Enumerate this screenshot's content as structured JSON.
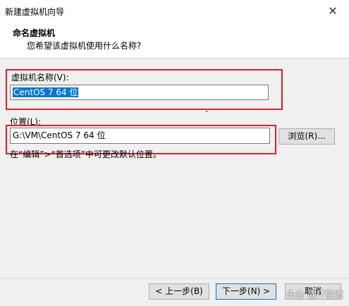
{
  "window": {
    "title": "新建虚拟机向导",
    "close_glyph": "✕"
  },
  "header": {
    "title": "命名虚拟机",
    "subtitle": "您希望该虚拟机使用什么名称?"
  },
  "name_field": {
    "label": "虚拟机名称(V):",
    "value": "CentOS 7 64 位"
  },
  "location_field": {
    "label": "位置(L):",
    "value": "G:\\VM\\CentOS 7 64 位",
    "browse_label": "浏览(R)...",
    "hint": "在“编辑”>“首选项”中可更改默认位置。"
  },
  "buttons": {
    "back_label": "< 上一步(B)",
    "next_label": "下一步(N) >",
    "cancel_label": "取消"
  },
  "watermark": "头条 @IT信道",
  "colors": {
    "highlight": "#0078d7",
    "annotation_red": "#e0202a"
  }
}
